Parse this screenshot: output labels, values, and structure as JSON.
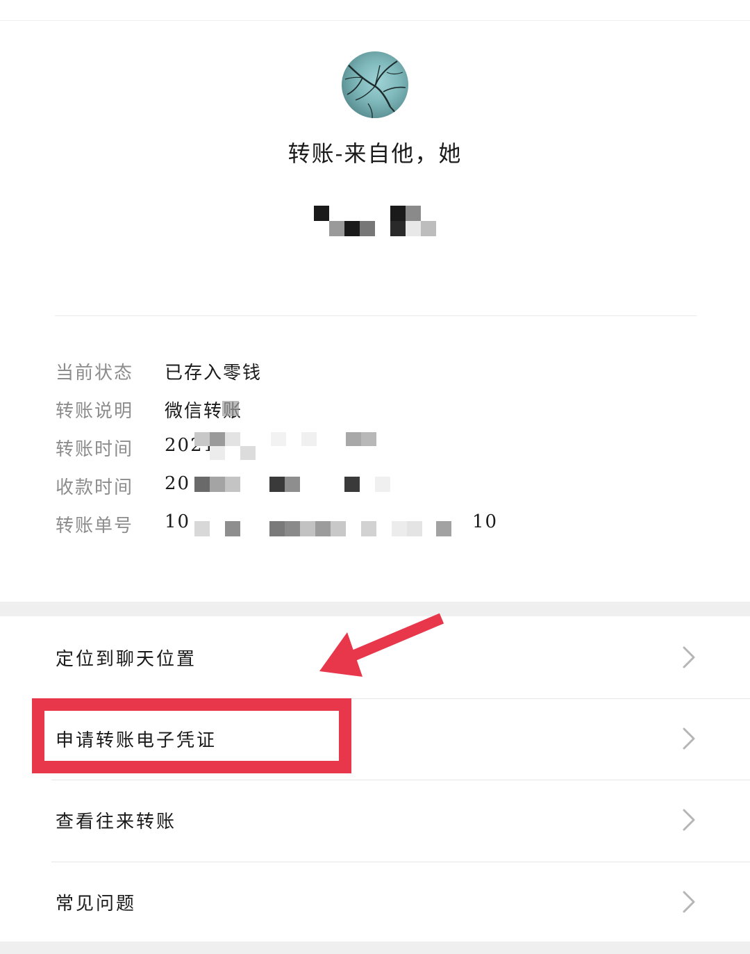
{
  "header": {
    "title": "转账-来自他，她"
  },
  "details": [
    {
      "label": "当前状态",
      "value": "已存入零钱"
    },
    {
      "label": "转账说明",
      "value": "微信转账"
    },
    {
      "label": "转账时间",
      "value": "2021"
    },
    {
      "label": "收款时间",
      "value": "20"
    },
    {
      "label": "转账单号",
      "value": "10",
      "value_tail": "10"
    }
  ],
  "menu": [
    {
      "label": "定位到聊天位置",
      "icon": "chevron-right-icon"
    },
    {
      "label": "申请转账电子凭证",
      "icon": "chevron-right-icon"
    },
    {
      "label": "查看往来转账",
      "icon": "chevron-right-icon"
    },
    {
      "label": "常见问题",
      "icon": "chevron-right-icon"
    }
  ],
  "colors": {
    "annotation": "#e8364b",
    "label_gray": "#8c8c8c",
    "text": "#1a1a1a",
    "band": "#efefef"
  }
}
